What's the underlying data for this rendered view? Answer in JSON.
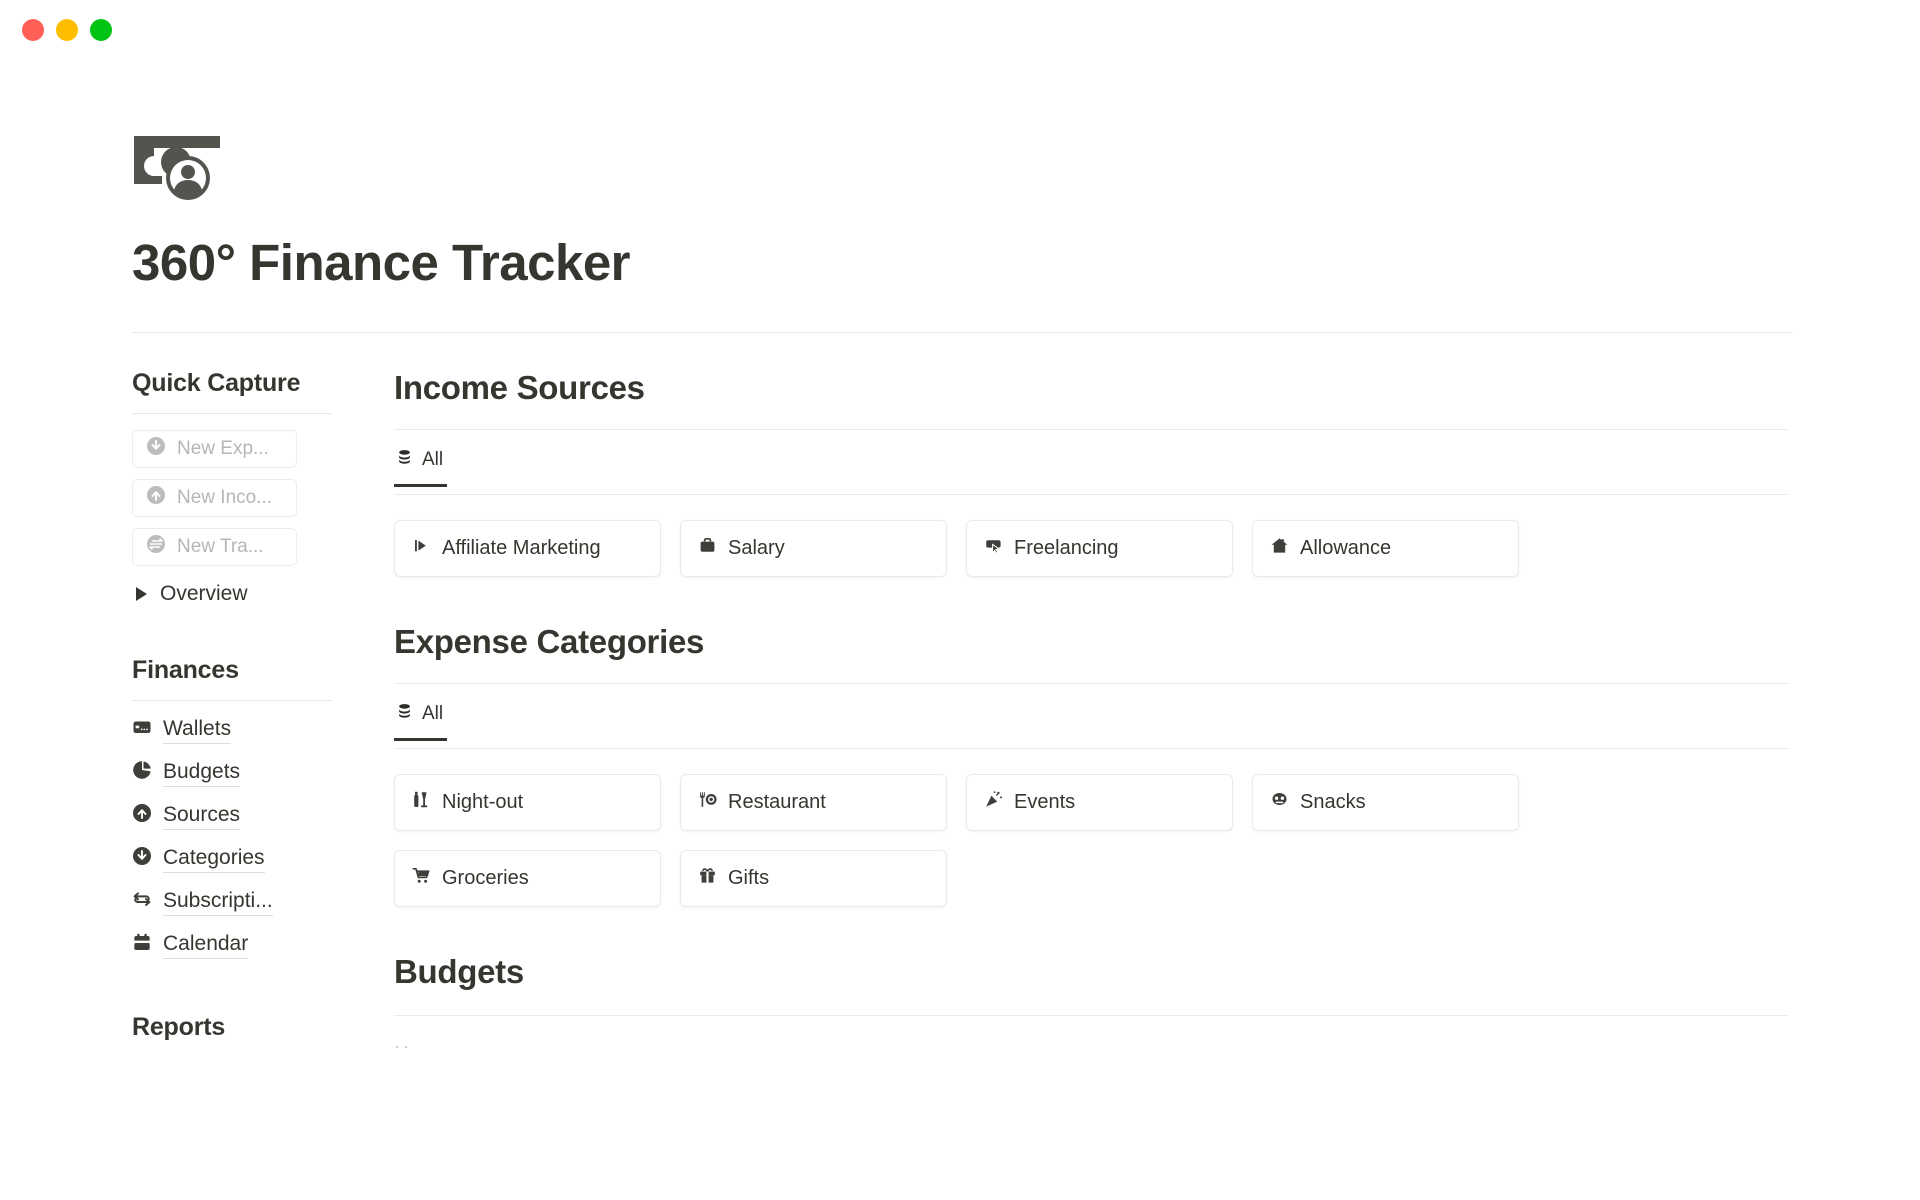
{
  "window": {
    "controls": [
      {
        "name": "close",
        "color": "#FF5F56"
      },
      {
        "name": "minimize",
        "color": "#FFBD00"
      },
      {
        "name": "maximize",
        "color": "#00C413"
      }
    ]
  },
  "header": {
    "logo_icon": "banknote-portrait-icon",
    "title": "360° Finance Tracker"
  },
  "sidebar": {
    "quick_capture": {
      "heading": "Quick Capture",
      "buttons": [
        {
          "label": "New Exp...",
          "icon": "arrow-down-circle-icon"
        },
        {
          "label": "New Inco...",
          "icon": "arrow-up-circle-icon"
        },
        {
          "label": "New Tra...",
          "icon": "transfer-circle-icon"
        }
      ],
      "overview": {
        "label": "Overview",
        "icon": "triangle-right-icon"
      }
    },
    "finances": {
      "heading": "Finances",
      "items": [
        {
          "label": "Wallets",
          "icon": "credit-card-icon"
        },
        {
          "label": "Budgets",
          "icon": "pie-chart-icon"
        },
        {
          "label": "Sources",
          "icon": "arrow-up-circle-icon"
        },
        {
          "label": "Categories",
          "icon": "arrow-down-circle-icon"
        },
        {
          "label": "Subscripti...",
          "icon": "refresh-sync-icon"
        },
        {
          "label": "Calendar",
          "icon": "calendar-icon"
        }
      ]
    },
    "reports": {
      "heading": "Reports"
    }
  },
  "main": {
    "income_sources": {
      "title": "Income Sources",
      "tabs": [
        {
          "label": "All",
          "icon": "database-stack-icon",
          "active": true
        }
      ],
      "cards": [
        {
          "label": "Affiliate Marketing",
          "icon": "flag-play-icon"
        },
        {
          "label": "Salary",
          "icon": "briefcase-icon"
        },
        {
          "label": "Freelancing",
          "icon": "cursor-click-icon"
        },
        {
          "label": "Allowance",
          "icon": "house-icon"
        }
      ]
    },
    "expense_categories": {
      "title": "Expense Categories",
      "tabs": [
        {
          "label": "All",
          "icon": "database-stack-icon",
          "active": true
        }
      ],
      "cards": [
        {
          "label": "Night-out",
          "icon": "bottle-glass-icon"
        },
        {
          "label": "Restaurant",
          "icon": "fork-plate-icon"
        },
        {
          "label": "Events",
          "icon": "confetti-icon"
        },
        {
          "label": "Snacks",
          "icon": "pretzel-icon"
        },
        {
          "label": "Groceries",
          "icon": "shopping-cart-icon"
        },
        {
          "label": "Gifts",
          "icon": "gift-icon"
        }
      ]
    },
    "budgets": {
      "title": "Budgets"
    }
  },
  "colors": {
    "text": "#37352F",
    "muted": "#B6B6B4",
    "border": "#EAEAE8",
    "background": "#FFFFFF"
  }
}
